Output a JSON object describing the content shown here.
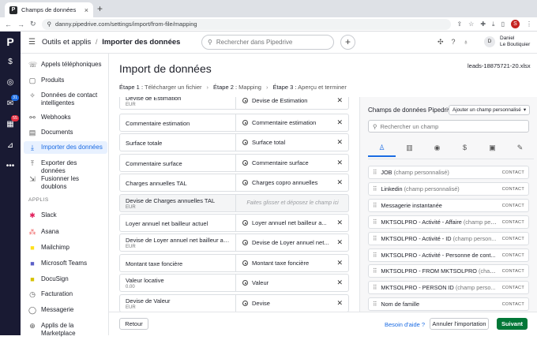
{
  "browser": {
    "tab_title": "Champs de données",
    "url": "danny.pipedrive.com/settings/import/from-file/mapping",
    "profile_initial": "S"
  },
  "rail": {
    "logo": "P",
    "mail_badge": "31",
    "calendar_badge": "55"
  },
  "header": {
    "crumb_parent": "Outils et applis",
    "crumb_sep": "/",
    "crumb_current": "Importer des données",
    "search_placeholder": "Rechercher dans Pipedrive",
    "avatar_initial": "D",
    "user_first": "Daniel",
    "user_last": "Le Boutiquier"
  },
  "sidebar": {
    "items": [
      {
        "label": "Appels téléphoniques",
        "icon": "phone-icon",
        "glyph": "☏"
      },
      {
        "label": "Produits",
        "icon": "box-icon",
        "glyph": "▢"
      },
      {
        "label": "Données de contact intelligentes",
        "icon": "sparkle-icon",
        "glyph": "✧"
      },
      {
        "label": "Webhooks",
        "icon": "webhook-icon",
        "glyph": "⚯"
      },
      {
        "label": "Documents",
        "icon": "document-icon",
        "glyph": "▤"
      },
      {
        "label": "Importer des données",
        "icon": "import-icon",
        "glyph": "⤓"
      },
      {
        "label": "Exporter des données",
        "icon": "export-icon",
        "glyph": "⤒"
      },
      {
        "label": "Fusionner les doublons",
        "icon": "merge-icon",
        "glyph": "⇲"
      }
    ],
    "apps_heading": "APPLIS",
    "apps": [
      {
        "label": "Slack",
        "icon": "slack-icon",
        "glyph": "✱",
        "color": "#e01e5a"
      },
      {
        "label": "Asana",
        "icon": "asana-icon",
        "glyph": "⁂",
        "color": "#f06a6a"
      },
      {
        "label": "Mailchimp",
        "icon": "mailchimp-icon",
        "glyph": "■",
        "color": "#ffe01b"
      },
      {
        "label": "Microsoft Teams",
        "icon": "teams-icon",
        "glyph": "■",
        "color": "#5b5fc7"
      },
      {
        "label": "DocuSign",
        "icon": "docusign-icon",
        "glyph": "■",
        "color": "#d6c100"
      },
      {
        "label": "Facturation",
        "icon": "billing-icon",
        "glyph": "◷",
        "color": "#555555"
      },
      {
        "label": "Messagerie",
        "icon": "chat-icon",
        "glyph": "◯",
        "color": "#555555"
      },
      {
        "label": "Applis de la Marketplace",
        "icon": "marketplace-icon",
        "glyph": "⊕",
        "color": "#555555"
      }
    ]
  },
  "main": {
    "title": "Import de données",
    "file_name": "leads-18875721-20.xlsx",
    "steps": [
      {
        "num": "Étape 1 :",
        "label": "Télécharger un fichier"
      },
      {
        "num": "Étape 2 :",
        "label": "Mapping"
      },
      {
        "num": "Étape 3 :",
        "label": "Aperçu et terminer"
      }
    ],
    "drop_placeholder": "Faites glisser et déposez le champ ici",
    "rows": [
      {
        "src": "Devise de Estimation",
        "sub": "EUR",
        "dst": "Devise de Estimation"
      },
      {
        "src": "Commentaire estimation",
        "sub": "",
        "dst": "Commentaire estimation"
      },
      {
        "src": "Surface totale",
        "sub": "",
        "dst": "Surface total"
      },
      {
        "src": "Commentaire surface",
        "sub": "",
        "dst": "Commentaire surface"
      },
      {
        "src": "Charges annuelles TAL",
        "sub": "",
        "dst": "Charges copro annuelles"
      },
      {
        "src": "Devise de Charges annuelles TAL",
        "sub": "EUR",
        "dst": ""
      },
      {
        "src": "Loyer annuel net bailleur actuel",
        "sub": "",
        "dst": "Loyer annuel net bailleur a..."
      },
      {
        "src": "Devise de Loyer annuel net bailleur act...",
        "sub": "EUR",
        "dst": "Devise de Loyer annuel net..."
      },
      {
        "src": "Montant taxe foncière",
        "sub": "",
        "dst": "Montant taxe foncière"
      },
      {
        "src": "Valeur locative",
        "sub": "0.00",
        "dst": "Valeur"
      },
      {
        "src": "Devise de Valeur",
        "sub": "EUR",
        "dst": "Devise"
      }
    ]
  },
  "panel": {
    "title": "Champs de données Pipedrive",
    "select_value": "Ajouter un champ personnalisé",
    "search_placeholder": "Rechercher un champ",
    "tabs": [
      {
        "icon": "person-icon",
        "glyph": "♙"
      },
      {
        "icon": "building-icon",
        "glyph": "▥"
      },
      {
        "icon": "target-icon",
        "glyph": "◉"
      },
      {
        "icon": "dollar-icon",
        "glyph": "$"
      },
      {
        "icon": "calendar-icon",
        "glyph": "▣"
      },
      {
        "icon": "note-icon",
        "glyph": "✎"
      }
    ],
    "fields": [
      {
        "name": "JOB",
        "custom": " (champ personnalisé)",
        "tag": "CONTACT"
      },
      {
        "name": "Linkedin",
        "custom": " (champ personnalisé)",
        "tag": "CONTACT"
      },
      {
        "name": "Messagerie instantanée",
        "custom": "",
        "tag": "CONTACT"
      },
      {
        "name": "MKTSOLPRO - Activité - Affaire",
        "custom": " (champ pers...",
        "tag": "CONTACT"
      },
      {
        "name": "MKTSOLPRO - Activité - ID",
        "custom": " (champ person...",
        "tag": "CONTACT"
      },
      {
        "name": "MKTSOLPRO - Activité - Personne de cont...",
        "custom": "",
        "tag": "CONTACT"
      },
      {
        "name": "MKTSOLPRO - FROM MKTSOLPRO",
        "custom": " (champ...",
        "tag": "CONTACT"
      },
      {
        "name": "MKTSOLPRO - PERSON ID",
        "custom": " (champ perso...",
        "tag": "CONTACT"
      },
      {
        "name": "Nom de famille",
        "custom": "",
        "tag": "CONTACT"
      }
    ]
  },
  "footer": {
    "back": "Retour",
    "help": "Besoin d'aide ?",
    "cancel": "Annuler l'importation",
    "next": "Suivant"
  }
}
